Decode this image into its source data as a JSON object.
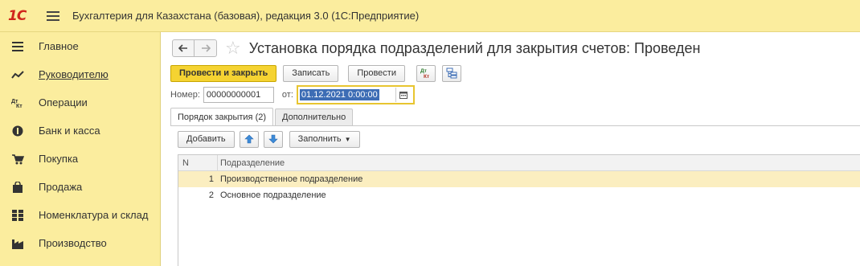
{
  "app": {
    "logo": "1С",
    "title": "Бухгалтерия для Казахстана (базовая), редакция 3.0  (1С:Предприятие)"
  },
  "sidebar": {
    "items": [
      {
        "label": "Главное",
        "icon": "list-icon"
      },
      {
        "label": "Руководителю",
        "icon": "chart-line-icon"
      },
      {
        "label": "Операции",
        "icon": "dt-kt-icon",
        "icon_text": "Дт Кт"
      },
      {
        "label": "Банк и касса",
        "icon": "coin-icon"
      },
      {
        "label": "Покупка",
        "icon": "cart-icon"
      },
      {
        "label": "Продажа",
        "icon": "bag-icon"
      },
      {
        "label": "Номенклатура и склад",
        "icon": "grid-icon"
      },
      {
        "label": "Производство",
        "icon": "factory-icon"
      }
    ]
  },
  "document": {
    "title": "Установка порядка подразделений для закрытия счетов: Проведен",
    "toolbar": {
      "post_close": "Провести и закрыть",
      "save": "Записать",
      "post": "Провести"
    },
    "number_label": "Номер:",
    "number_value": "00000000001",
    "date_label": "от:",
    "date_value": "01.12.2021  0:00:00",
    "tabs": [
      "Порядок закрытия (2)",
      "Дополнительно"
    ],
    "table_toolbar": {
      "add": "Добавить",
      "fill": "Заполнить"
    },
    "table": {
      "columns": [
        "N",
        "Подразделение"
      ],
      "rows": [
        {
          "n": "1",
          "name": "Производственное подразделение"
        },
        {
          "n": "2",
          "name": "Основное подразделение"
        }
      ]
    }
  },
  "colors": {
    "panel": "#fbed9e",
    "primary_button": "#f5d332",
    "selected_row": "#fbeec0",
    "date_highlight": "#3d6db5",
    "logo": "#d0261b"
  }
}
